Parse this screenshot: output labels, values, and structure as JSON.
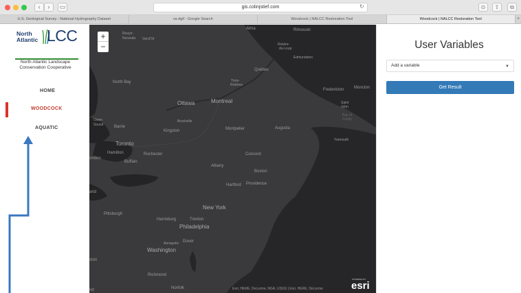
{
  "browser": {
    "address": "gis.colinjstief.com",
    "tabs": [
      "U.S. Geological Survey - National Hydrography Dataset",
      "va dgif - Google Search",
      "Woodcock | NALCC Restoration Tool",
      "Woodcock | NALCC Restoration Tool"
    ],
    "tab_add": "+"
  },
  "sidebar": {
    "logo_line1": "North",
    "logo_line2": "Atlantic",
    "logo_lcc": "LCC",
    "logo_subtitle_1": "North Atlantic Landscape",
    "logo_subtitle_2": "Conservation Cooperative",
    "nav": {
      "home": "HOME",
      "woodcock": "WOODCOCK",
      "aquatic": "AQUATIC"
    }
  },
  "map": {
    "zoom_in": "+",
    "zoom_out": "−",
    "attribution": "Esri, HERE, DeLorme, NGA, USGS | Esri, HERE, DeLorme",
    "powered_by": "POWERED BY",
    "esri": "esri",
    "labels": {
      "alma": "Alma",
      "rimouski": "Rimouski",
      "rouyn": "Rouyn-",
      "noranda": "Noranda",
      "valdor": "Val-d'Or",
      "riviere": "Rivière-",
      "duloup": "du-Loup",
      "edmundston": "Edmundston",
      "quebec": "Québec",
      "northbay": "North Bay",
      "trois": "Trois-",
      "rivieres": "Rivières",
      "fredericton": "Fredericton",
      "moncton": "Moncton",
      "saint": "Saint",
      "john": "John",
      "bayof": "Bay of",
      "fundy": "Fundy",
      "ottawa": "Ottawa",
      "montreal": "Montreal",
      "owen": "Owen",
      "sound": "Sound",
      "barrie": "Barrie",
      "brockville": "Brockville",
      "kingston": "Kingston",
      "montpelier": "Montpelier",
      "augusta": "Augusta",
      "yarmouth": "Yarmouth",
      "toronto": "Toronto",
      "hamilton": "Hamilton",
      "ondon": "ondon",
      "buffalo": "Buffalo",
      "rochester": "Rochester",
      "concord": "Concord",
      "albany": "Albany",
      "boston": "Boston",
      "hartford": "Hartford",
      "providence": "Providence",
      "and": "and",
      "newyork": "New York",
      "pittsburgh": "Pittsburgh",
      "harrisburg": "Harrisburg",
      "trenton": "Trenton",
      "philadelphia": "Philadelphia",
      "annapolis": "Annapolis",
      "dover": "Dover",
      "washington": "Washington",
      "ston": "ston",
      "richmond": "Richmond",
      "norfolk": "Norfolk",
      "nd": "nd"
    }
  },
  "panel": {
    "title": "User Variables",
    "select_placeholder": "Add a variable",
    "button": "Get Result"
  },
  "colors": {
    "brand_blue": "#1f3f6e",
    "active_red": "#c0392b",
    "button_blue": "#337ab7",
    "map_land": "#2e2e30",
    "arrow_blue": "#3a78c2"
  }
}
